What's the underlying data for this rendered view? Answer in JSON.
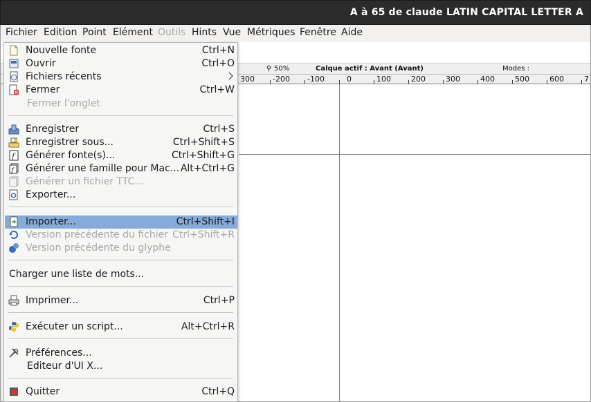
{
  "window": {
    "title": "A à 65 de claude LATIN CAPITAL LETTER A"
  },
  "menubar": [
    {
      "label": "Fichier",
      "enabled": true
    },
    {
      "label": "Edition",
      "enabled": true
    },
    {
      "label": "Point",
      "enabled": true
    },
    {
      "label": "Elément",
      "enabled": true
    },
    {
      "label": "Outils",
      "enabled": false
    },
    {
      "label": "Hints",
      "enabled": true
    },
    {
      "label": "Vue",
      "enabled": true
    },
    {
      "label": "Métriques",
      "enabled": true
    },
    {
      "label": "Fenêtre",
      "enabled": true
    },
    {
      "label": "Aide",
      "enabled": true
    }
  ],
  "info": {
    "zoom": "50%",
    "layer": "Calque actif : Avant (Avant)",
    "modes": "Modes :"
  },
  "ruler": [
    "300",
    "-200",
    "-100",
    "0",
    "100",
    "200",
    "300",
    "400",
    "500",
    "600",
    "7"
  ],
  "file_menu": {
    "new_font": {
      "label": "Nouvelle fonte",
      "shortcut": "Ctrl+N"
    },
    "open": {
      "label": "Ouvrir",
      "shortcut": "Ctrl+O"
    },
    "recent": {
      "label": "Fichiers récents"
    },
    "close": {
      "label": "Fermer",
      "shortcut": "Ctrl+W"
    },
    "close_tab": {
      "label": "Fermer l'onglet"
    },
    "save": {
      "label": "Enregistrer",
      "shortcut": "Ctrl+S"
    },
    "save_as": {
      "label": "Enregistrer sous...",
      "shortcut": "Ctrl+Shift+S"
    },
    "generate_fonts": {
      "label": "Générer fonte(s)...",
      "shortcut": "Ctrl+Shift+G"
    },
    "generate_mac_family": {
      "label": "Générer une famille pour Mac...",
      "shortcut": "Alt+Ctrl+G"
    },
    "generate_ttc": {
      "label": "Générer un fichier TTC..."
    },
    "export": {
      "label": "Exporter..."
    },
    "import": {
      "label": "Importer...",
      "shortcut": "Ctrl+Shift+I"
    },
    "revert_file": {
      "label": "Version précédente du fichier",
      "shortcut": "Ctrl+Shift+R"
    },
    "revert_glyph": {
      "label": "Version précédente du glyphe"
    },
    "load_word_list": {
      "label": "Charger une liste de mots..."
    },
    "print": {
      "label": "Imprimer...",
      "shortcut": "Ctrl+P"
    },
    "run_script": {
      "label": "Exécuter un script...",
      "shortcut": "Alt+Ctrl+R"
    },
    "preferences": {
      "label": "Préférences..."
    },
    "x_ui_editor": {
      "label": "Editeur d'UI X..."
    },
    "quit": {
      "label": "Quitter",
      "shortcut": "Ctrl+Q"
    }
  },
  "colors": {
    "highlight": "#86abd9",
    "titlebar": "#2b2b2b",
    "menu_bg": "#f6f6f5",
    "disabled_text": "#a8a8a8"
  }
}
